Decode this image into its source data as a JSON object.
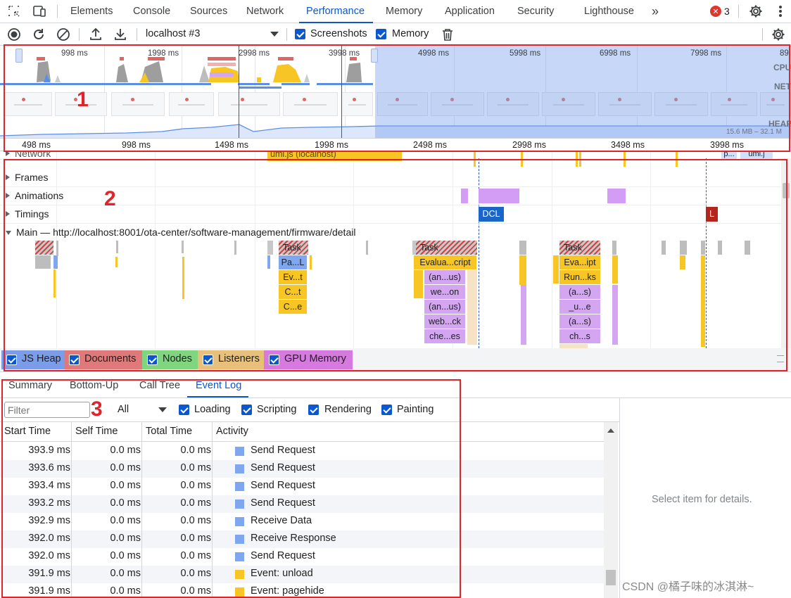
{
  "tabs": {
    "items": [
      "Elements",
      "Console",
      "Sources",
      "Network",
      "Performance",
      "Memory",
      "Application",
      "Security",
      "Lighthouse"
    ],
    "active": "Performance",
    "error_count": "3"
  },
  "toolbar": {
    "target": "localhost #3",
    "screenshots_label": "Screenshots",
    "memory_label": "Memory"
  },
  "overview": {
    "top_ticks": [
      "998 ms",
      "1998 ms",
      "2998 ms",
      "3998 ms",
      "4998 ms",
      "5998 ms",
      "6998 ms",
      "7998 ms",
      "89"
    ],
    "labels": {
      "cpu": "CPU",
      "net": "NET",
      "heap": "HEAP"
    },
    "heap_range": "15.6 MB – 32.1 M",
    "ruler": [
      "498 ms",
      "998 ms",
      "1498 ms",
      "1998 ms",
      "2498 ms",
      "2998 ms",
      "3498 ms",
      "3998 ms"
    ]
  },
  "flame": {
    "network_label": "Network",
    "network_item": "umi.js (localhost)",
    "network_item2": "umi.j",
    "network_item3": "p...",
    "frames_label": "Frames",
    "animations_label": "Animations",
    "timings_label": "Timings",
    "dcl": "DCL",
    "l": "L",
    "main_label": "Main — http://localhost:8001/ota-center/software-management/firmware/detail",
    "task": "Task",
    "stack1": [
      "Pa...L",
      "Ev...t",
      "C...t",
      "C...e"
    ],
    "stack2": [
      "Evalua...cript",
      "(an...us)",
      "we...on",
      "(an...us)",
      "web...ck",
      "che...es"
    ],
    "stack3": [
      "Eva...ipt",
      "Run...ks",
      "(a...s)",
      "_u...e",
      "(a...s)",
      "ch...s"
    ]
  },
  "memory_legend": [
    {
      "label": "JS Heap",
      "color": "#7b9ce8"
    },
    {
      "label": "Documents",
      "color": "#e07a7a"
    },
    {
      "label": "Nodes",
      "color": "#7fd67f"
    },
    {
      "label": "Listeners",
      "color": "#e8c07a"
    },
    {
      "label": "GPU Memory",
      "color": "#d77ae0"
    }
  ],
  "bottom": {
    "tabs": [
      "Summary",
      "Bottom-Up",
      "Call Tree",
      "Event Log"
    ],
    "active_tab": "Event Log",
    "filter_placeholder": "Filter",
    "all_label": "All",
    "categories": [
      "Loading",
      "Scripting",
      "Rendering",
      "Painting"
    ],
    "columns": [
      "Start Time",
      "Self Time",
      "Total Time",
      "Activity"
    ],
    "rows": [
      {
        "start": "393.9 ms",
        "self": "0.0 ms",
        "total": "0.0 ms",
        "activity": "Send Request",
        "color": "#7fa7ef"
      },
      {
        "start": "393.6 ms",
        "self": "0.0 ms",
        "total": "0.0 ms",
        "activity": "Send Request",
        "color": "#7fa7ef"
      },
      {
        "start": "393.4 ms",
        "self": "0.0 ms",
        "total": "0.0 ms",
        "activity": "Send Request",
        "color": "#7fa7ef"
      },
      {
        "start": "393.2 ms",
        "self": "0.0 ms",
        "total": "0.0 ms",
        "activity": "Send Request",
        "color": "#7fa7ef"
      },
      {
        "start": "392.9 ms",
        "self": "0.0 ms",
        "total": "0.0 ms",
        "activity": "Receive Data",
        "color": "#7fa7ef"
      },
      {
        "start": "392.0 ms",
        "self": "0.0 ms",
        "total": "0.0 ms",
        "activity": "Receive Response",
        "color": "#7fa7ef"
      },
      {
        "start": "392.0 ms",
        "self": "0.0 ms",
        "total": "0.0 ms",
        "activity": "Send Request",
        "color": "#7fa7ef"
      },
      {
        "start": "391.9 ms",
        "self": "0.0 ms",
        "total": "0.0 ms",
        "activity": "Event: unload",
        "color": "#f7c624"
      },
      {
        "start": "391.9 ms",
        "self": "0.0 ms",
        "total": "0.0 ms",
        "activity": "Event: pagehide",
        "color": "#f7c624"
      }
    ],
    "details_text": "Select item for details."
  },
  "annotations": {
    "n1": "1",
    "n2": "2",
    "n3": "3"
  },
  "watermark": "CSDN @橘子味的冰淇淋~"
}
